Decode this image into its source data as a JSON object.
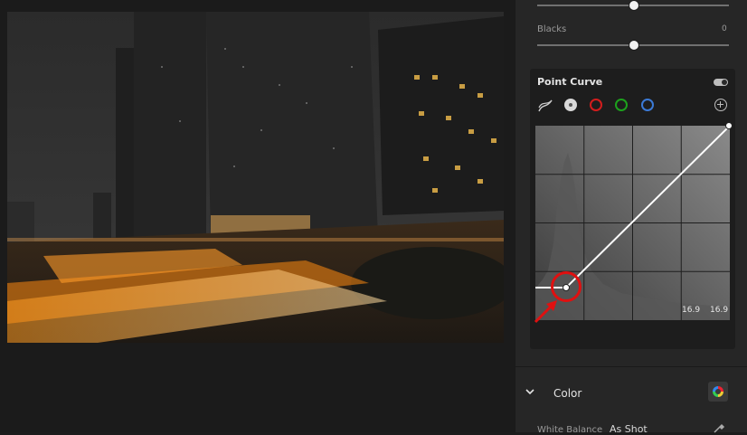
{
  "panel": {
    "blacks_label": "Blacks",
    "blacks_value": "0",
    "point_curve_title": "Point Curve",
    "curve_readout_input": "16.9",
    "curve_readout_output": "16.9",
    "color_section": "Color",
    "white_balance_label": "White Balance",
    "white_balance_value": "As Shot"
  },
  "channels": [
    {
      "name": "parametric",
      "color": "#cfcfcf"
    },
    {
      "name": "luminance",
      "color": "#d9d9d9"
    },
    {
      "name": "red",
      "color": "#d31d1d"
    },
    {
      "name": "green",
      "color": "#1da11d"
    },
    {
      "name": "blue",
      "color": "#3b7ad6"
    }
  ],
  "colors": {
    "annotation": "#e01010",
    "panel_bg": "#262626",
    "curve_line": "#ffffff"
  }
}
